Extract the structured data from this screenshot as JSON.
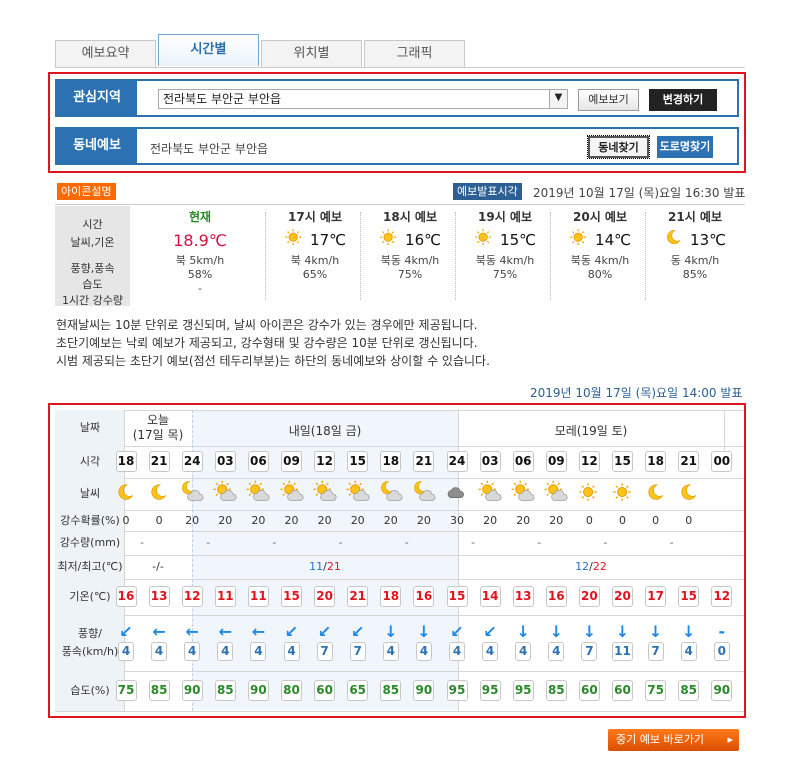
{
  "tabs": [
    "예보요약",
    "시간별",
    "위치별",
    "그래픽"
  ],
  "active_tab": 1,
  "region": {
    "label": "관심지역",
    "selected": "전라북도 부안군 부안읍",
    "view_button": "예보보기",
    "change_button": "변경하기"
  },
  "town": {
    "label": "동네예보",
    "address": "전라북도 부안군 부안읍",
    "find_button": "동네찾기",
    "road_button": "도로명찾기"
  },
  "icon_desc": "아이콘설명",
  "issue_label": "예보발표시각",
  "issue_time": "2019년 10월 17일 (목)요일 16:30 발표",
  "current": {
    "row1": "시간",
    "row2": "날씨,기온",
    "row3": "풍향,풍속",
    "row4": "습도",
    "row5": "1시간 강수량",
    "now_label": "현재",
    "now_temp": "18.9℃",
    "now_wind": "북 5km/h",
    "now_humid": "58%",
    "now_rain": "-"
  },
  "forecasts": [
    {
      "time": "17시 예보",
      "icon": "sun-icon",
      "temp": "17℃",
      "wind": "북 4km/h",
      "humid": "65%"
    },
    {
      "time": "18시 예보",
      "icon": "sun-icon",
      "temp": "16℃",
      "wind": "북동 4km/h",
      "humid": "75%"
    },
    {
      "time": "19시 예보",
      "icon": "sun-icon",
      "temp": "15℃",
      "wind": "북동 4km/h",
      "humid": "75%"
    },
    {
      "time": "20시 예보",
      "icon": "sun-icon",
      "temp": "14℃",
      "wind": "북동 4km/h",
      "humid": "80%"
    },
    {
      "time": "21시 예보",
      "icon": "moon-icon",
      "temp": "13℃",
      "wind": "동 4km/h",
      "humid": "85%"
    }
  ],
  "notes": [
    "현재날씨는 10분 단위로 갱신되며, 날씨 아이콘은 강수가 있는 경우에만 제공됩니다.",
    "초단기예보는 낙뢰 예보가 제공되고, 강수형태 및 강수량은 10분 단위로 갱신됩니다.",
    "시범 제공되는 초단기 예보(점선 테두리부분)는 하단의 동네예보와 상이할 수 있습니다."
  ],
  "table_issue": "2019년 10월 17일 (목)요일 14:00 발표",
  "table": {
    "labels": {
      "date": "날짜",
      "time": "시각",
      "weather": "날씨",
      "prob": "강수확률(%)",
      "amount": "강수량(mm)",
      "minmax": "최저/최고(℃)",
      "temp": "기온(℃)",
      "wind": "풍향/\n풍속(km/h)",
      "humid": "습도(%)"
    },
    "day0": "오늘\n(17일 목)",
    "day1": "내일(18일 금)",
    "day2": "모레(19일 토)",
    "times": [
      "18",
      "21",
      "24",
      "03",
      "06",
      "09",
      "12",
      "15",
      "18",
      "21",
      "24",
      "03",
      "06",
      "09",
      "12",
      "15",
      "18",
      "21",
      "00"
    ],
    "weather": [
      "moon",
      "moon",
      "pcloud-moon",
      "pcloud",
      "pcloud",
      "pcloud",
      "pcloud",
      "pcloud",
      "pcloud-moon",
      "pcloud-moon",
      "cloud",
      "pcloud",
      "pcloud",
      "pcloud",
      "sun",
      "sun",
      "moon",
      "moon"
    ],
    "prob": [
      "0",
      "0",
      "20",
      "20",
      "20",
      "20",
      "20",
      "20",
      "20",
      "20",
      "30",
      "20",
      "20",
      "20",
      "0",
      "0",
      "0",
      "0"
    ],
    "amount": [
      "-",
      "-",
      "-",
      "-",
      "-",
      "-",
      "-",
      "-",
      "-"
    ],
    "minmax_today": "-/-",
    "min_d1": "11",
    "max_d1": "21",
    "min_d2": "12",
    "max_d2": "22",
    "temps": [
      "16",
      "13",
      "12",
      "11",
      "11",
      "15",
      "20",
      "21",
      "18",
      "16",
      "15",
      "14",
      "13",
      "16",
      "20",
      "20",
      "17",
      "15",
      "12"
    ],
    "wind_dir": [
      "↙",
      "←",
      "←",
      "←",
      "←",
      "↙",
      "↙",
      "↙",
      "↓",
      "↓",
      "↙",
      "↙",
      "↓",
      "↓",
      "↓",
      "↓",
      "↓",
      "↓",
      "-"
    ],
    "wind_spd": [
      "4",
      "4",
      "4",
      "4",
      "4",
      "4",
      "7",
      "7",
      "4",
      "4",
      "4",
      "4",
      "4",
      "4",
      "7",
      "11",
      "7",
      "4",
      "0"
    ],
    "humid": [
      "75",
      "85",
      "90",
      "85",
      "90",
      "80",
      "60",
      "65",
      "85",
      "90",
      "95",
      "95",
      "95",
      "85",
      "60",
      "60",
      "75",
      "85",
      "90"
    ]
  },
  "mid_button": "중기 예보 바로가기",
  "colors": {
    "red": "#e0141e",
    "blue": "#2c72b2",
    "green": "#2a8a2a",
    "orange": "#ff7a1a"
  }
}
